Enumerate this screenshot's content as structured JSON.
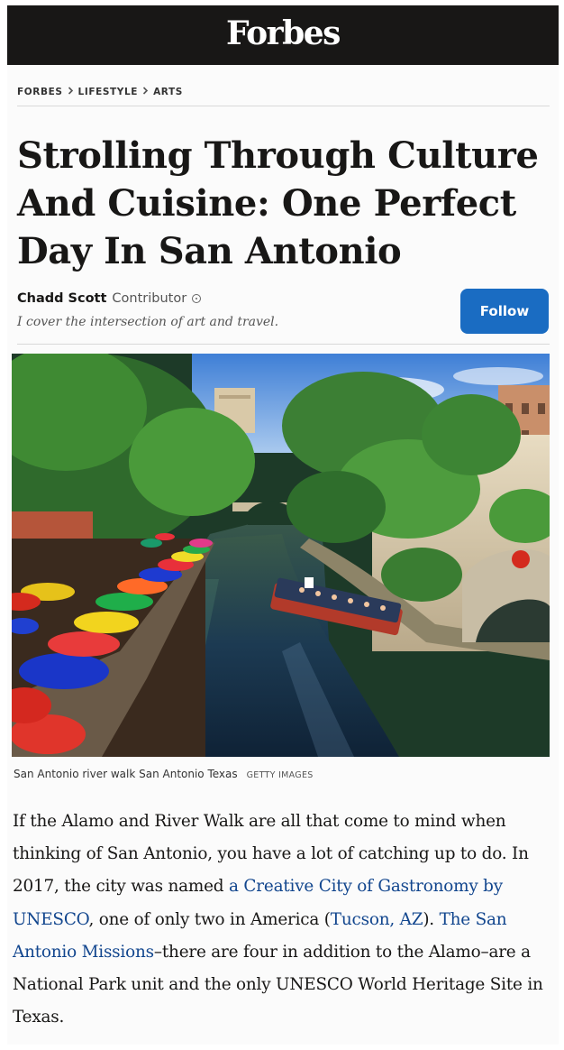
{
  "colors": {
    "masthead_bg": "#181716",
    "follow_button_bg": "#1a6cc2",
    "link": "#12468e"
  },
  "masthead": {
    "logo": "Forbes"
  },
  "breadcrumb": {
    "items": [
      "FORBES",
      "LIFESTYLE",
      "ARTS"
    ],
    "separator_icon": "chevron-right-icon"
  },
  "article": {
    "headline": "Strolling Through Culture And Cuisine: One Perfect Day In San Antonio",
    "author": {
      "name": "Chadd Scott",
      "role": "Contributor",
      "info_icon": "info-icon",
      "tagline": "I cover the intersection of art and travel.",
      "follow_label": "Follow"
    },
    "image": {
      "caption": "San Antonio river walk San Antonio Texas",
      "credit": "GETTY IMAGES"
    },
    "paragraph": {
      "part1": "If the Alamo and River Walk are all that come to mind when thinking of San Antonio, you have a lot of catching up to do. In 2017, the city was named ",
      "link1": "a Creative City of Gastronomy by UNESCO",
      "part2": ", one of only two in America (",
      "link2": "Tucson, AZ",
      "part3": "). ",
      "link3": "The San Antonio Missions",
      "part4": "–there are four in addition to the Alamo–are a National Park unit and the only UNESCO World Heritage Site in Texas."
    }
  }
}
